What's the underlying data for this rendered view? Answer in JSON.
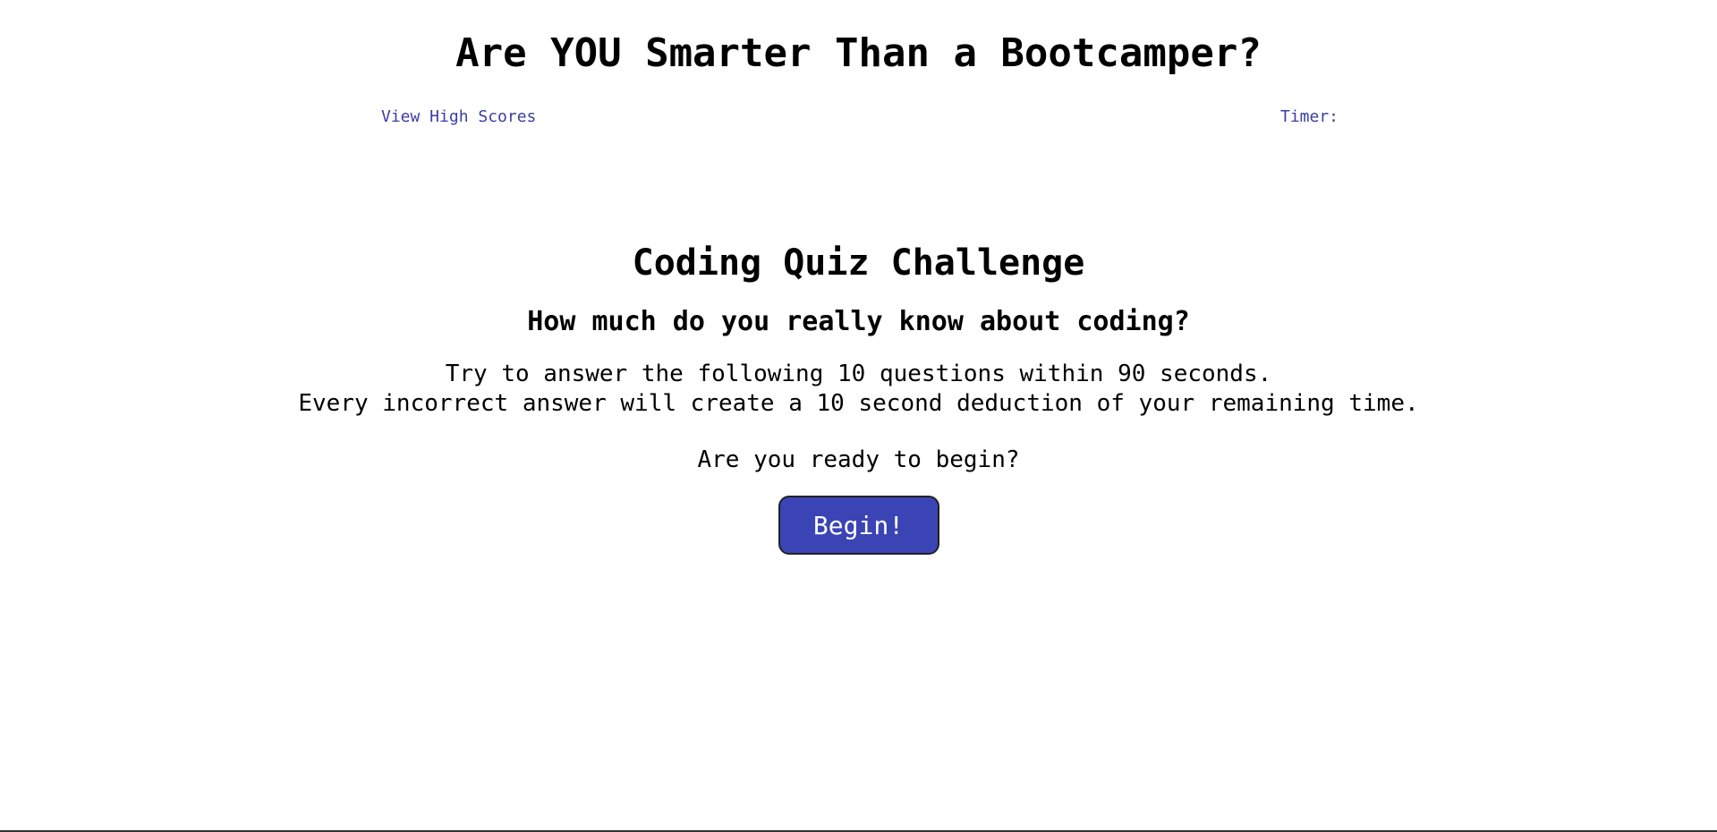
{
  "header": {
    "title": "Are YOU Smarter Than a Bootcamper?",
    "high_scores_link": "View High Scores",
    "timer_label": "Timer:"
  },
  "intro": {
    "heading": "Coding Quiz Challenge",
    "subheading": "How much do you really know about coding?",
    "rules_line1": "Try to answer the following 10 questions within 90 seconds.",
    "rules_line2": "Every incorrect answer will create a 10 second deduction of your remaining time.",
    "ready_prompt": "Are you ready to begin?",
    "begin_button": "Begin!"
  },
  "colors": {
    "link": "#3b3fa0",
    "button_bg": "#3b44b5",
    "button_text": "#ffffff"
  }
}
